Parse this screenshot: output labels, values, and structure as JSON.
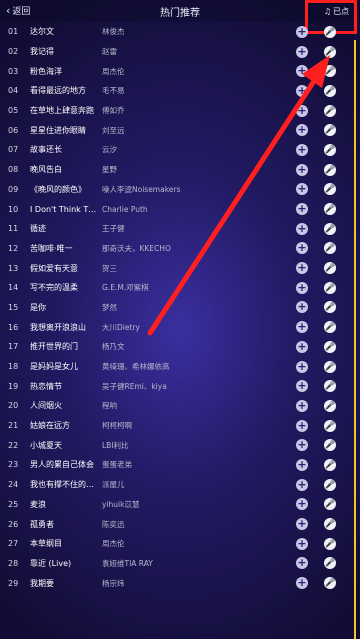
{
  "header": {
    "back_label": "返回",
    "title": "热门推荐",
    "status_label": "已点"
  },
  "songs": [
    {
      "num": "01",
      "title": "达尔文",
      "artist": "林俊杰"
    },
    {
      "num": "02",
      "title": "我记得",
      "artist": "赵雷"
    },
    {
      "num": "03",
      "title": "粉色海洋",
      "artist": "周杰伦"
    },
    {
      "num": "04",
      "title": "看得最远的地方",
      "artist": "毛不易"
    },
    {
      "num": "05",
      "title": "在草地上肆意奔跑",
      "artist": "傅如乔"
    },
    {
      "num": "06",
      "title": "星星住进你眼睛",
      "artist": "刘至远"
    },
    {
      "num": "07",
      "title": "故事还长",
      "artist": "云汐"
    },
    {
      "num": "08",
      "title": "晚风告白",
      "artist": "星野"
    },
    {
      "num": "09",
      "title": "《晚风的颜色》",
      "artist": "噪人李逵Noisemakers"
    },
    {
      "num": "10",
      "title": "I Don't Think That...",
      "artist": "Charlie Puth"
    },
    {
      "num": "11",
      "title": "循迹",
      "artist": "王子健"
    },
    {
      "num": "12",
      "title": "苦咖啡·唯一",
      "artist": "那奇沃夫，KKECHO"
    },
    {
      "num": "13",
      "title": "假如爱有天意",
      "artist": "贺三"
    },
    {
      "num": "14",
      "title": "写不完的温柔",
      "artist": "G.E.M.邓紫棋"
    },
    {
      "num": "15",
      "title": "是你",
      "artist": "梦然"
    },
    {
      "num": "16",
      "title": "我想离开浪浪山",
      "artist": "大川Dietry"
    },
    {
      "num": "17",
      "title": "推开世界的门",
      "artist": "杨乃文"
    },
    {
      "num": "18",
      "title": "是妈妈是女儿",
      "artist": "黄绮珊、希林娜依高"
    },
    {
      "num": "19",
      "title": "热恋情节",
      "artist": "吴子健REmi、kiya"
    },
    {
      "num": "20",
      "title": "人间烟火",
      "artist": "程响"
    },
    {
      "num": "21",
      "title": "姑娘在远方",
      "artist": "柯柯柯啊"
    },
    {
      "num": "22",
      "title": "小城夏天",
      "artist": "LBI利比"
    },
    {
      "num": "23",
      "title": "男人的累自己体会",
      "artist": "蛋蛋老弟"
    },
    {
      "num": "24",
      "title": "我也有撑不住的时...",
      "artist": "派屋儿"
    },
    {
      "num": "25",
      "title": "麦浪",
      "artist": "yihuik苡慧"
    },
    {
      "num": "26",
      "title": "孤勇者",
      "artist": "陈奕迅"
    },
    {
      "num": "27",
      "title": "本草纲目",
      "artist": "周杰伦"
    },
    {
      "num": "28",
      "title": "靠近 (Live)",
      "artist": "袁娅维TIA RAY"
    },
    {
      "num": "29",
      "title": "我期要",
      "artist": "杨宗纬"
    }
  ],
  "icons": {
    "add": "plus-circle-icon",
    "sing": "microphone-icon"
  },
  "colors": {
    "scrollbar": "#f5c623",
    "annotation": "#ff1f1f"
  }
}
